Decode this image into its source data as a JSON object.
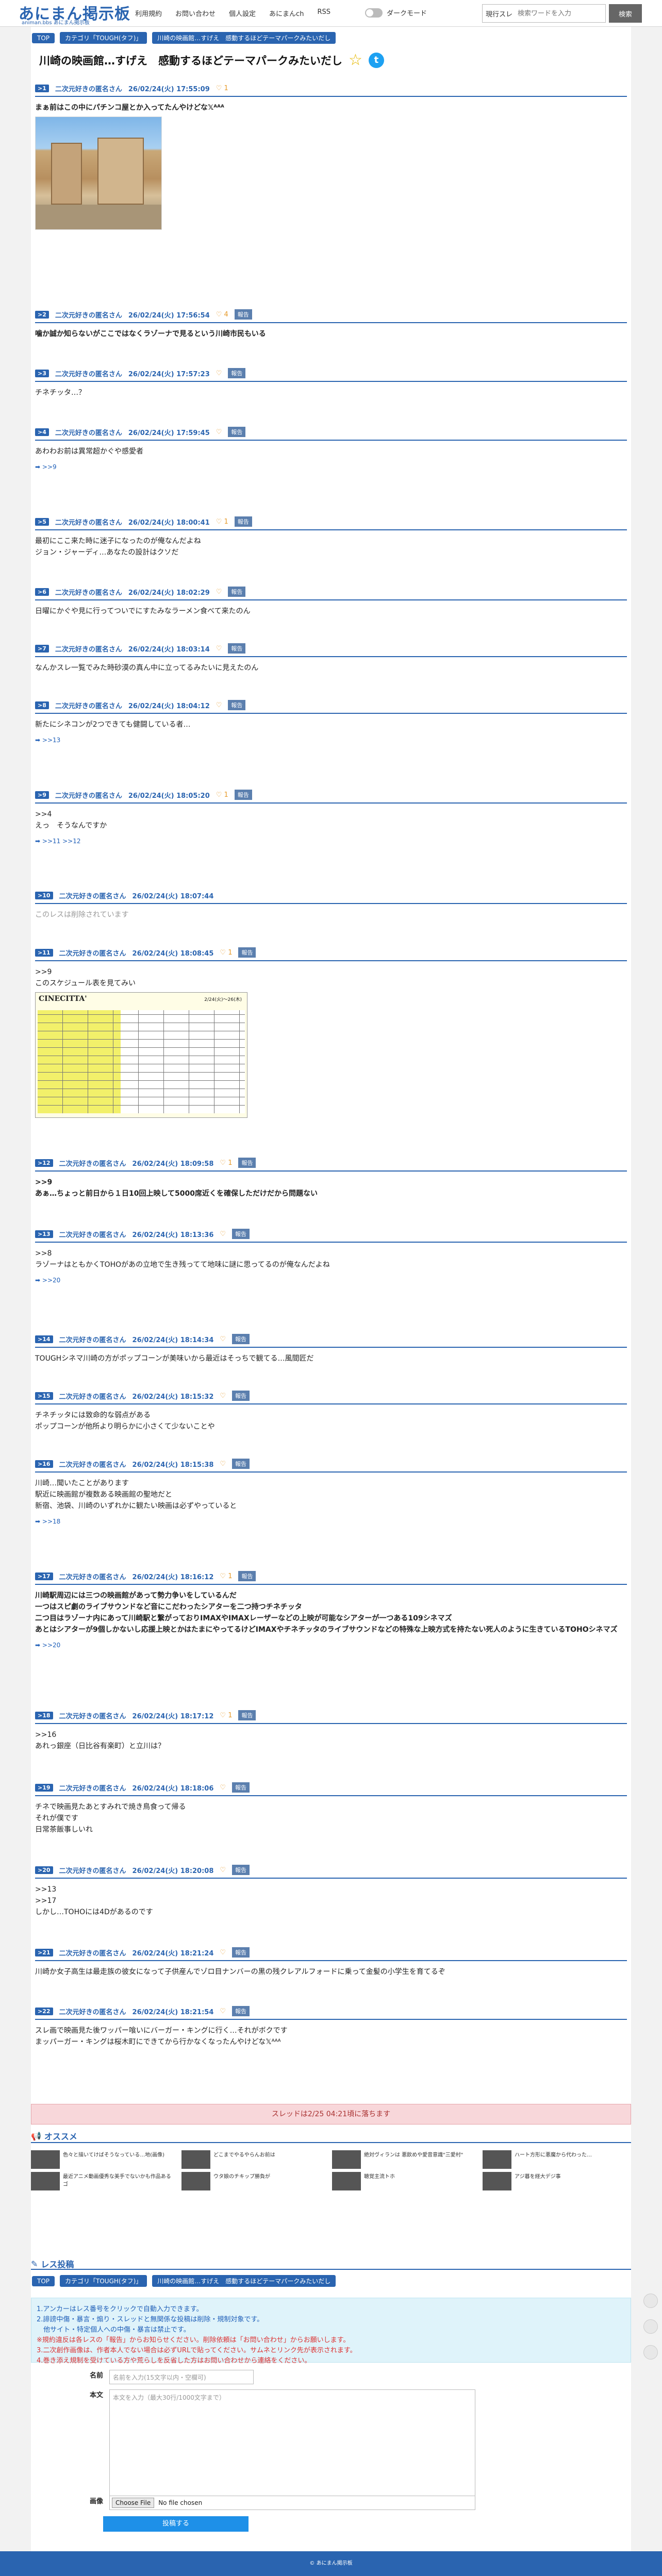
{
  "header": {
    "logo": "あにまん掲示板",
    "logo_sub": "animan.bbs あにまん掲示板",
    "nav": [
      "利用規約",
      "お問い合わせ",
      "個人設定",
      "あにまんch",
      "RSS"
    ],
    "dark_mode": "ダークモード",
    "search_mode": "現行スレ",
    "search_placeholder": "検索ワードを入力",
    "search_button": "検索"
  },
  "breadcrumb": [
    "TOP",
    "カテゴリ「TOUGH(タフ)」",
    "川崎の映画館…すげえ　感動するほどテーマパークみたいだし"
  ],
  "title": "川崎の映画館…すげえ　感動するほどテーマパークみたいだし",
  "posts": [
    {
      "num": ">1",
      "name": "二次元好きの匿名さん",
      "date": "26/02/24(火) 17:55:09",
      "likes": "1",
      "body": "まぁ前はこの中にパチンコ屋とか入ってたんやけどな𝕏ᴬᴬᴬ"
    },
    {
      "num": ">2",
      "name": "二次元好きの匿名さん",
      "date": "26/02/24(火) 17:56:54",
      "likes": "4",
      "body": "噛か誠か知らないがここではなくラゾーナで見るという川崎市民もいる"
    },
    {
      "num": ">3",
      "name": "二次元好きの匿名さん",
      "date": "26/02/24(火) 17:57:23",
      "likes": "",
      "body": "チネチッタ…？"
    },
    {
      "num": ">4",
      "name": "二次元好きの匿名さん",
      "date": "26/02/24(火) 17:59:45",
      "likes": "",
      "body": "あわわお前は異常超かぐや感愛者",
      "reply": ">>9"
    },
    {
      "num": ">5",
      "name": "二次元好きの匿名さん",
      "date": "26/02/24(火) 18:00:41",
      "likes": "1",
      "body": "最初にここ来た時に迷子になったのが俺なんだよね\nジョン・ジャーディ…あなたの設計はクソだ"
    },
    {
      "num": ">6",
      "name": "二次元好きの匿名さん",
      "date": "26/02/24(火) 18:02:29",
      "likes": "",
      "body": "日曜にかぐや見に行ってついでにすたみなラーメン食べて来たのん"
    },
    {
      "num": ">7",
      "name": "二次元好きの匿名さん",
      "date": "26/02/24(火) 18:03:14",
      "likes": "",
      "body": "なんかスレ一覧でみた時砂漠の真ん中に立ってるみたいに見えたのん"
    },
    {
      "num": ">8",
      "name": "二次元好きの匿名さん",
      "date": "26/02/24(火) 18:04:12",
      "likes": "",
      "body": "新たにシネコンが2つできても健闘している者…",
      "reply": ">>13"
    },
    {
      "num": ">9",
      "name": "二次元好きの匿名さん",
      "date": "26/02/24(火) 18:05:20",
      "likes": "1",
      "body": ">>4\nえっ　そうなんですか",
      "reply": ">>11 >>12"
    },
    {
      "num": ">10",
      "name": "二次元好きの匿名さん",
      "date": "26/02/24(火) 18:07:44",
      "likes": "",
      "body": "このレスは削除されています"
    },
    {
      "num": ">11",
      "name": "二次元好きの匿名さん",
      "date": "26/02/24(火) 18:08:45",
      "likes": "1",
      "body": ">>9\nこのスケジュール表を見てみい"
    },
    {
      "num": ">12",
      "name": "二次元好きの匿名さん",
      "date": "26/02/24(火) 18:09:58",
      "likes": "1",
      "body": ">>9\nあぁ…ちょっと前日から１日10回上映して5000席近くを確保しただけだから問題ない"
    },
    {
      "num": ">13",
      "name": "二次元好きの匿名さん",
      "date": "26/02/24(火) 18:13:36",
      "likes": "",
      "body": ">>8\nラゾーナはともかくTOHOがあの立地で生き残ってて地味に謎に思ってるのが俺なんだよね",
      "reply": ">>20"
    },
    {
      "num": ">14",
      "name": "二次元好きの匿名さん",
      "date": "26/02/24(火) 18:14:34",
      "likes": "",
      "body": "TOUGHシネマ川崎の方がポップコーンが美味いから最近はそっちで観てる…風間匠だ"
    },
    {
      "num": ">15",
      "name": "二次元好きの匿名さん",
      "date": "26/02/24(火) 18:15:32",
      "likes": "",
      "body": "チネチッタには致命的な弱点がある\nポップコーンが他所より明らかに小さくて少ないことや"
    },
    {
      "num": ">16",
      "name": "二次元好きの匿名さん",
      "date": "26/02/24(火) 18:15:38",
      "likes": "",
      "body": "川崎…聞いたことがあります\n駅近に映画館が複数ある映画館の聖地だと\n新宿、池袋、川崎のいずれかに観たい映画は必ずやっていると",
      "reply": ">>18"
    },
    {
      "num": ">17",
      "name": "二次元好きの匿名さん",
      "date": "26/02/24(火) 18:16:12",
      "likes": "1",
      "body": "川崎駅周辺には三つの映画館があって勢力争いをしているんだ\n一つはスピ劇のライブサウンドなど音にこだわったシアターを二つ持つチネチッタ\n二つ目はラゾーナ内にあって川崎駅と繋がっておりIMAXやIMAXレーザーなどの上映が可能なシアターが一つある109シネマズ\nあとはシアターが9個しかないし応援上映とかはたまにやってるけどIMAXやチネチッタのライブサウンドなどの特殊な上映方式を持たない死人のように生きているTOHOシネマズ",
      "reply": ">>20"
    },
    {
      "num": ">18",
      "name": "二次元好きの匿名さん",
      "date": "26/02/24(火) 18:17:12",
      "likes": "1",
      "body": ">>16\nあれっ銀座（日比谷有楽町）と立川は？"
    },
    {
      "num": ">19",
      "name": "二次元好きの匿名さん",
      "date": "26/02/24(火) 18:18:06",
      "likes": "",
      "body": "チネで映画見たあとすみれで焼き鳥食って帰る\nそれが僕です\n日常茶飯事しいれ"
    },
    {
      "num": ">20",
      "name": "二次元好きの匿名さん",
      "date": "26/02/24(火) 18:20:08",
      "likes": "",
      "body": ">>13\n>>17\nしかし…TOHOには4Dがあるのです"
    },
    {
      "num": ">21",
      "name": "二次元好きの匿名さん",
      "date": "26/02/24(火) 18:21:24",
      "likes": "",
      "body": "川崎か女子高生は最走族の彼女になって子供産んでゾロ目ナンバーの黒の残クレアルフォードに乗って金髪の小学生を育てるぞ"
    },
    {
      "num": ">22",
      "name": "二次元好きの匿名さん",
      "date": "26/02/24(火) 18:21:54",
      "likes": "",
      "body": "スレ画で映画見た後ワッパー喰いにバーガー・キングに行く…それがボクです\nまッパーガー・キングは桜木町にできてから行かなくなったんやけどな𝕏ᴬᴬᴬ"
    }
  ],
  "deadline": "スレッドは2/25 04:21頃に落ちます",
  "recommend": {
    "title": "オススメ",
    "items": [
      "色々と描いてけばそうなっている…地(画像)",
      "どこまでやるやらんお前は",
      "絶対ヴィランは 悪飲めや愛音意識\"三愛村\"",
      "ハート方形に悪魔から代わった…",
      "最近アニメ動画優秀な美手でないかも作品あるゴ",
      "ウタ娘のチキップ勝負が",
      "聴覚主流トホ",
      "アジ暮を経大デジ事"
    ]
  },
  "post_form": {
    "title": "レス投稿",
    "rules": [
      "1.アンカーはレス番号をクリックで自動入力できます。",
      "2.誹謗中傷・暴言・煽り・スレッドと無関係な投稿は削除・規制対象です。",
      "　他サイト・特定個人への中傷・暴言は禁止です。",
      "※規約違反は各レスの「報告」からお知らせください。削除依頼は「お問い合わせ」からお願いします。",
      "3.二次創作画像は、作者本人でない場合は必ずURLで貼ってください。サムネとリンク先が表示されます。",
      "4.巻き添え規制を受けている方や荒らしを反省した方はお問い合わせから連絡をください。"
    ],
    "name_label": "名前",
    "name_placeholder": "名前を入力(15文字以内・空欄可)",
    "body_label": "本文",
    "body_placeholder": "本文を入力（最大30行/1000文字まで）",
    "image_label": "画像",
    "file_button": "Choose File",
    "file_status": "No file chosen",
    "submit": "投稿する"
  },
  "footer": "© あにまん掲示板"
}
